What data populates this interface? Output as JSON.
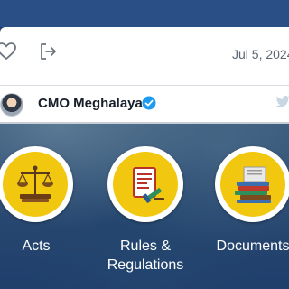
{
  "tweet": {
    "date": "Jul 5, 2024",
    "account_name": "CMO Meghalaya"
  },
  "icons": {
    "like": "heart-icon",
    "share": "share-icon",
    "verified": "verified-badge-icon",
    "platform": "twitter-bird-icon"
  },
  "tiles": [
    {
      "label": "Acts"
    },
    {
      "label": "Rules &\nRegulations"
    },
    {
      "label": "Documents"
    }
  ],
  "colors": {
    "accent_yellow": "#f2c70f",
    "background_blue": "#1e3f6e",
    "verified_blue": "#1d9bf0"
  }
}
